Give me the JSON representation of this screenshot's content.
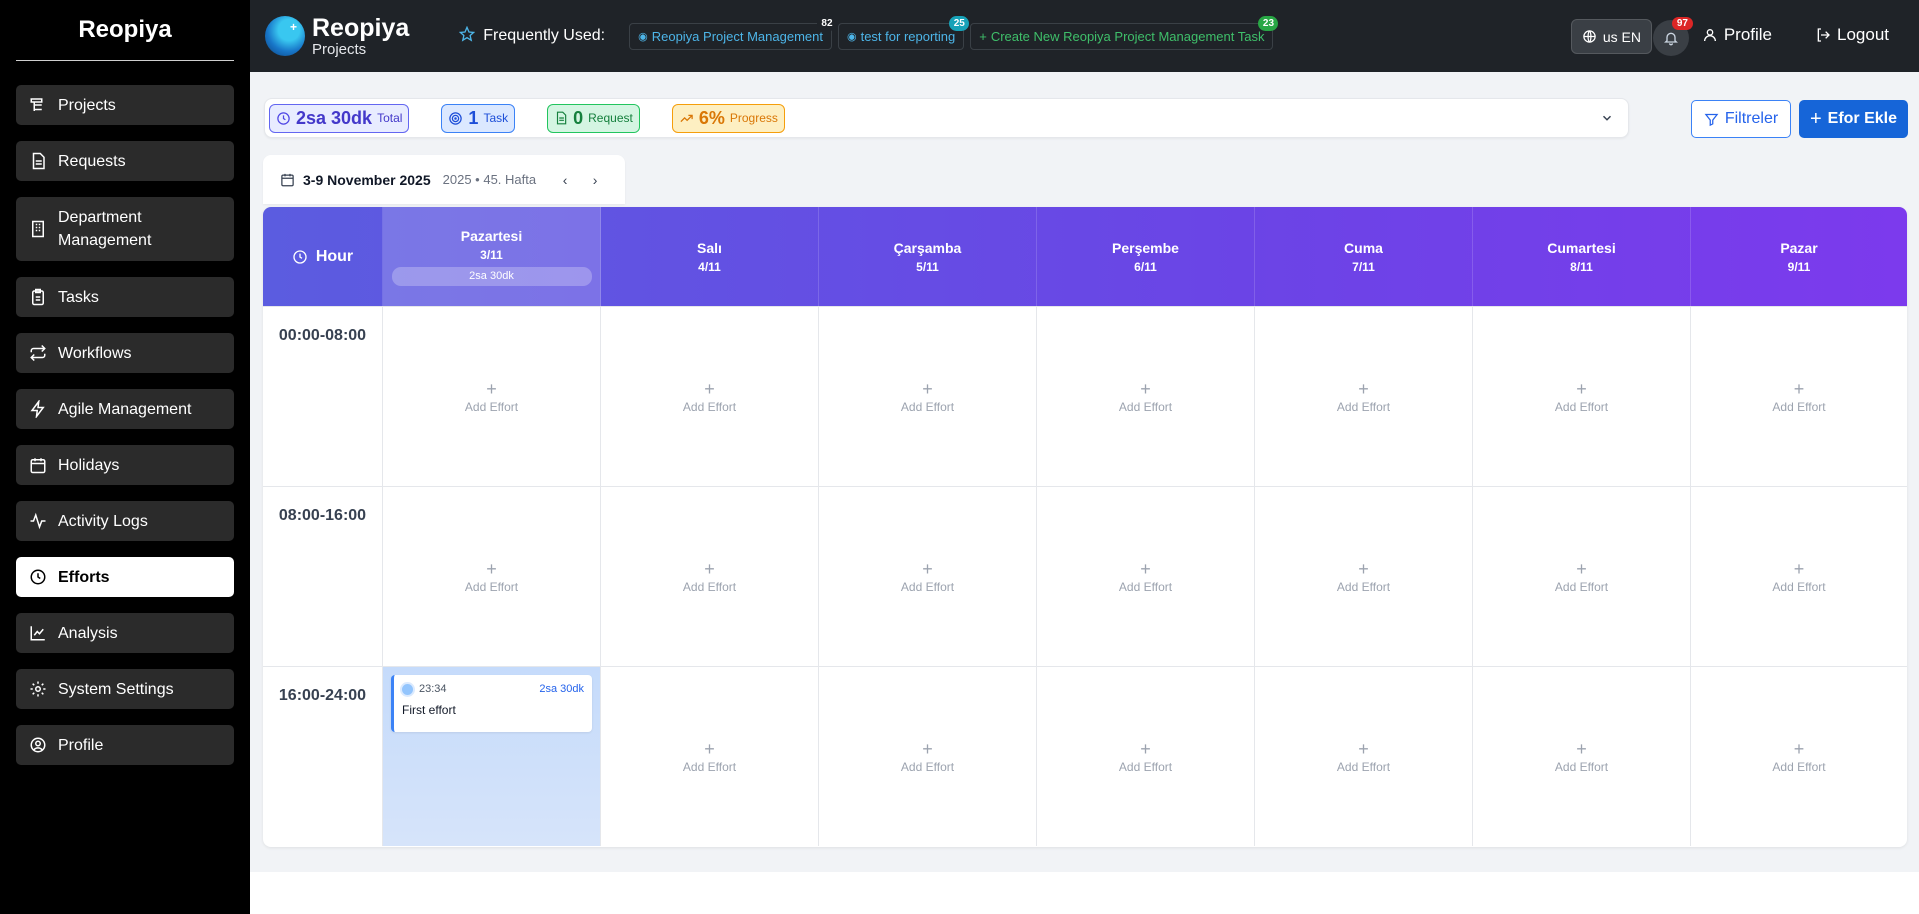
{
  "sidebar": {
    "brand": "Reopiya",
    "items": [
      {
        "label": "Projects",
        "icon": "projects-icon"
      },
      {
        "label": "Requests",
        "icon": "document-icon"
      },
      {
        "label": "Department Management",
        "icon": "building-icon"
      },
      {
        "label": "Tasks",
        "icon": "clipboard-icon"
      },
      {
        "label": "Workflows",
        "icon": "repeat-icon"
      },
      {
        "label": "Agile Management",
        "icon": "lightning-icon"
      },
      {
        "label": "Holidays",
        "icon": "calendar-icon"
      },
      {
        "label": "Activity Logs",
        "icon": "activity-icon"
      },
      {
        "label": "Efforts",
        "icon": "clock-icon",
        "active": true
      },
      {
        "label": "Analysis",
        "icon": "chart-icon"
      },
      {
        "label": "System Settings",
        "icon": "gear-icon"
      },
      {
        "label": "Profile",
        "icon": "user-circle-icon"
      }
    ]
  },
  "topbar": {
    "logo_title": "Reopiya",
    "logo_subtitle": "Projects",
    "frequently_used_label": "Frequently Used:",
    "chips": [
      {
        "label": "Reopiya Project Management",
        "badge": "82",
        "color": "#4db5e8",
        "badge_color": "#1f2328"
      },
      {
        "label": "test for reporting",
        "badge": "25",
        "color": "#4db5e8",
        "badge_color": "#17a2b8"
      },
      {
        "label": "Create New Reopiya Project Management Task",
        "badge": "23",
        "color": "#3fbf6a",
        "badge_color": "#28a745"
      }
    ],
    "language": "us EN",
    "notification_count": "97",
    "profile_label": "Profile",
    "logout_label": "Logout"
  },
  "summary": {
    "total_value": "2sa 30dk",
    "total_label": "Total",
    "task_value": "1",
    "task_label": "Task",
    "request_value": "0",
    "request_label": "Request",
    "progress_value": "6%",
    "progress_label": "Progress"
  },
  "actions": {
    "filter_label": "Filtreler",
    "add_label": "Efor Ekle"
  },
  "week": {
    "range": "3-9 November 2025",
    "sub": "2025 • 45. Hafta"
  },
  "grid": {
    "hour_label": "Hour",
    "days": [
      {
        "name": "Pazartesi",
        "date": "3/11",
        "total": "2sa 30dk"
      },
      {
        "name": "Salı",
        "date": "4/11"
      },
      {
        "name": "Çarşamba",
        "date": "5/11"
      },
      {
        "name": "Perşembe",
        "date": "6/11"
      },
      {
        "name": "Cuma",
        "date": "7/11"
      },
      {
        "name": "Cumartesi",
        "date": "8/11"
      },
      {
        "name": "Pazar",
        "date": "9/11"
      }
    ],
    "slots": [
      "00:00-08:00",
      "08:00-16:00",
      "16:00-24:00"
    ],
    "add_effort_label": "Add Effort",
    "effort": {
      "time": "23:34",
      "duration": "2sa 30dk",
      "title": "First effort"
    }
  }
}
